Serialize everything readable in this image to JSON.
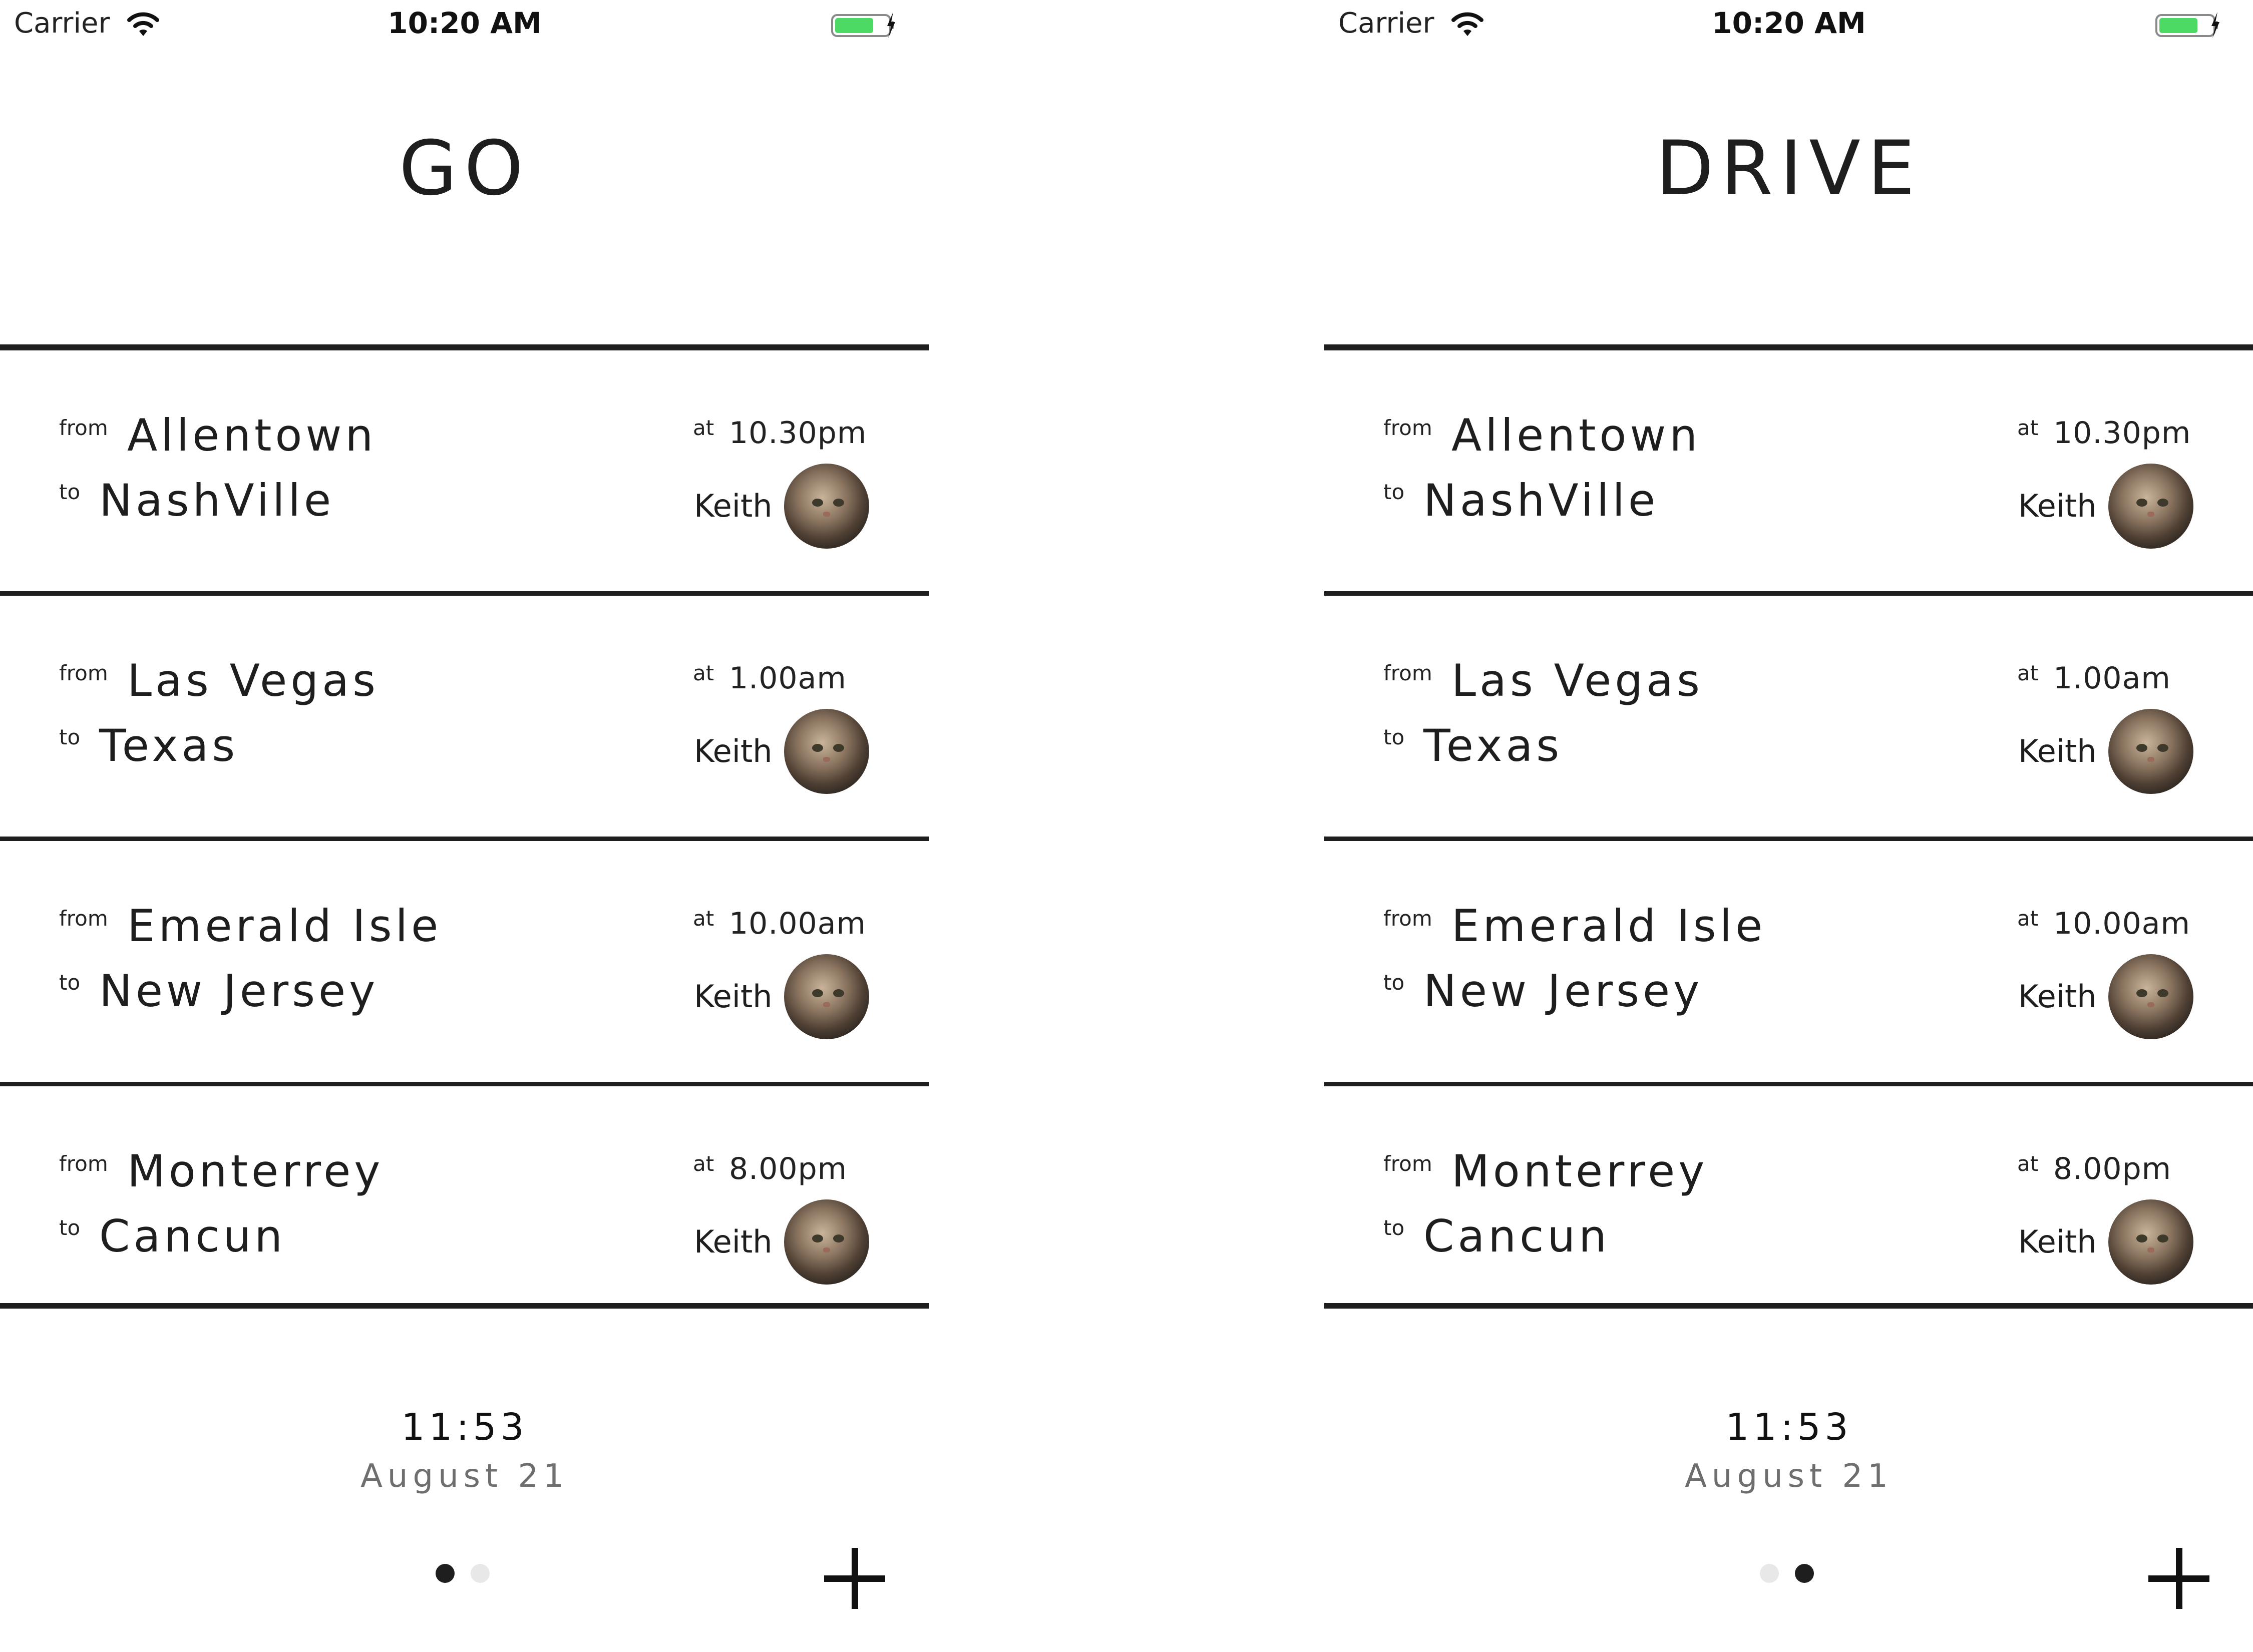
{
  "colors": {
    "ink": "#1e1e1e",
    "muted": "#6e6e6e",
    "battery": "#4cd964",
    "dot_inactive": "#e8e8e8"
  },
  "screens": [
    {
      "status": {
        "carrier": "Carrier",
        "time": "10:20 AM",
        "icons": [
          "wifi-icon",
          "battery-icon",
          "charging-bolt-icon"
        ]
      },
      "title": "GO",
      "labels": {
        "from": "from",
        "to": "to",
        "at": "at"
      },
      "trips": [
        {
          "from": "Allentown",
          "to": "NashVille",
          "time": "10.30pm",
          "driver": "Keith"
        },
        {
          "from": "Las Vegas",
          "to": "Texas",
          "time": "1.00am",
          "driver": "Keith"
        },
        {
          "from": "Emerald Isle",
          "to": "New Jersey",
          "time": "10.00am",
          "driver": "Keith"
        },
        {
          "from": "Monterrey",
          "to": "Cancun",
          "time": "8.00pm",
          "driver": "Keith"
        }
      ],
      "footer": {
        "time": "11:53",
        "date": "August 21"
      },
      "pager": {
        "pages": 2,
        "current": 1
      }
    },
    {
      "status": {
        "carrier": "Carrier",
        "time": "10:20 AM",
        "icons": [
          "wifi-icon",
          "battery-icon",
          "charging-bolt-icon"
        ]
      },
      "title": "DRIVE",
      "labels": {
        "from": "from",
        "to": "to",
        "at": "at"
      },
      "trips": [
        {
          "from": "Allentown",
          "to": "NashVille",
          "time": "10.30pm",
          "driver": "Keith"
        },
        {
          "from": "Las Vegas",
          "to": "Texas",
          "time": "1.00am",
          "driver": "Keith"
        },
        {
          "from": "Emerald Isle",
          "to": "New Jersey",
          "time": "10.00am",
          "driver": "Keith"
        },
        {
          "from": "Monterrey",
          "to": "Cancun",
          "time": "8.00pm",
          "driver": "Keith"
        }
      ],
      "footer": {
        "time": "11:53",
        "date": "August 21"
      },
      "pager": {
        "pages": 2,
        "current": 2
      }
    }
  ]
}
